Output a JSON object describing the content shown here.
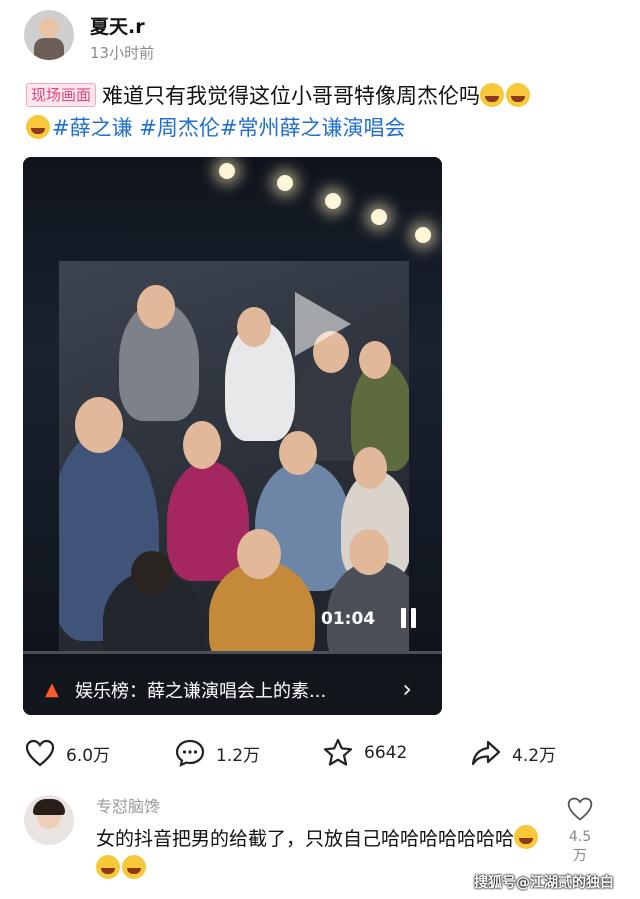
{
  "post": {
    "username": "夏天.r",
    "time": "13小时前",
    "tag": "现场画面",
    "text": "难道只有我觉得这位小哥哥特像周杰伦吗",
    "hashtags": [
      "#薛之谦",
      "#周杰伦",
      "#常州薛之谦演唱会"
    ]
  },
  "video": {
    "time": "01:04",
    "banner": "娱乐榜：薛之谦演唱会上的素..."
  },
  "actions": {
    "like_count": "6.0万",
    "comment_count": "1.2万",
    "favorite_count": "6642",
    "share_count": "4.2万"
  },
  "comment": {
    "user": "专怼脑馋",
    "text": "女的抖音把男的给截了，只放自己哈哈哈哈哈哈哈",
    "like_count": "4.5万"
  },
  "watermark": "搜狐号@江湖贰的独白",
  "colors": {
    "hashtag": "#1f6fd1",
    "tag": "#e0457a"
  }
}
